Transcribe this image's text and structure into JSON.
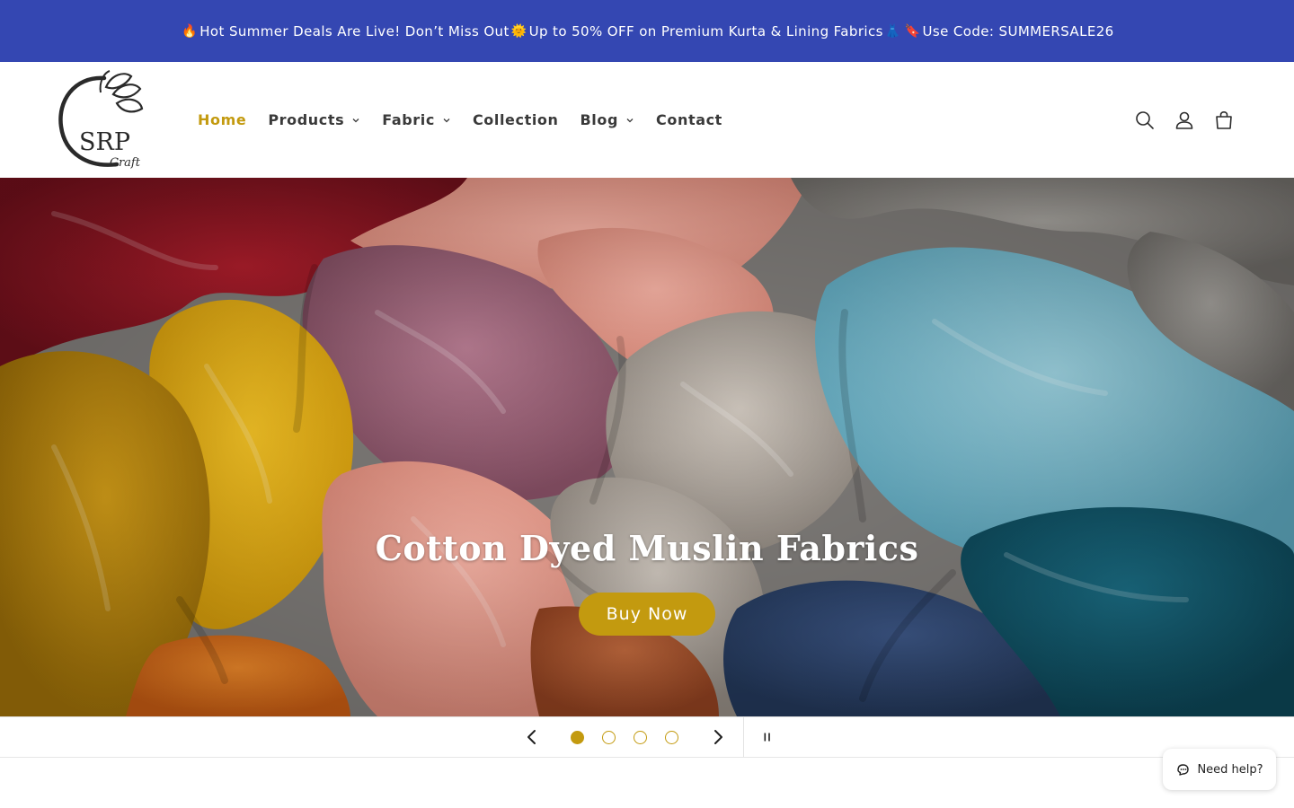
{
  "announcement": {
    "prefix_icon": "fire-emoji",
    "part1": "Hot Summer Deals Are Live! Don’t Miss Out",
    "sun_icon": "sun-emoji",
    "part2": "Up to 50% OFF on Premium Kurta & Lining Fabrics",
    "dress_icon": "dress-emoji",
    "tag_icon": "bookmark-emoji",
    "part3": "Use Code: SUMMERSALE26",
    "background": "#3447b2"
  },
  "brand": {
    "logo_main": "SRP",
    "logo_sub": "Craft"
  },
  "nav": {
    "items": [
      {
        "label": "Home",
        "active": true,
        "dropdown": false
      },
      {
        "label": "Products",
        "active": false,
        "dropdown": true
      },
      {
        "label": "Fabric",
        "active": false,
        "dropdown": true
      },
      {
        "label": "Collection",
        "active": false,
        "dropdown": false
      },
      {
        "label": "Blog",
        "active": false,
        "dropdown": true
      },
      {
        "label": "Contact",
        "active": false,
        "dropdown": false
      }
    ]
  },
  "header_icons": [
    "search-icon",
    "account-icon",
    "cart-icon"
  ],
  "hero": {
    "title": "Cotton Dyed Muslin Fabrics",
    "button_label": "Buy Now"
  },
  "slider": {
    "slide_count": 4,
    "active_slide": 1,
    "prev_icon": "chevron-left-icon",
    "next_icon": "chevron-right-icon",
    "pause_icon": "pause-icon"
  },
  "help_widget": {
    "label": "Need help?",
    "icon": "chat-hand-icon"
  },
  "colors": {
    "accent": "#c39a0f",
    "announce_bg": "#3447b2",
    "text": "#3a3a3a"
  }
}
